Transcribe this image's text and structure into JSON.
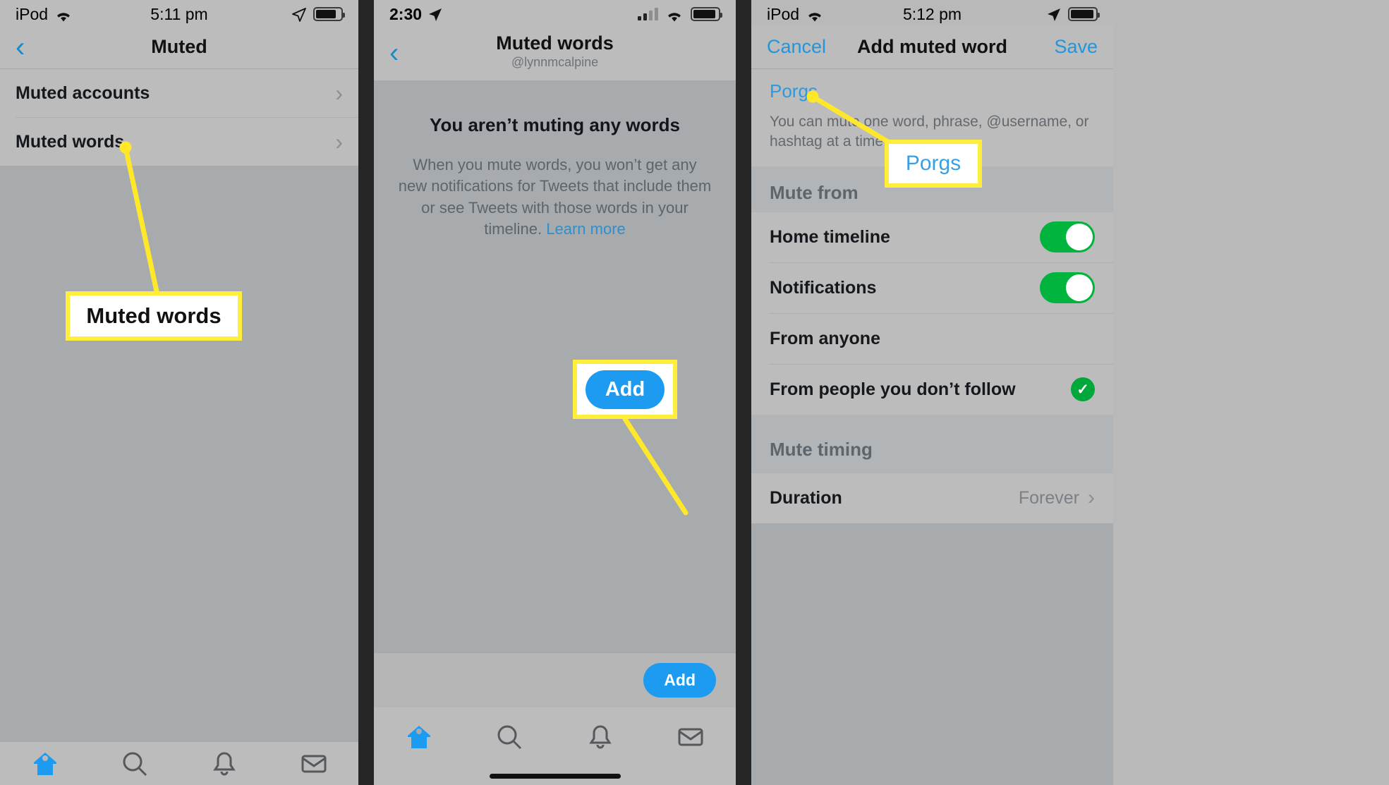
{
  "panel1": {
    "status": {
      "carrier": "iPod",
      "wifi_icon": "wifi-icon",
      "time": "5:11 pm",
      "location_icon": "location-arrow-icon",
      "battery_icon": "battery-icon"
    },
    "nav": {
      "back_icon": "chevron-left-icon",
      "title": "Muted"
    },
    "rows": [
      {
        "label": "Muted accounts",
        "chevron": "chevron-right-icon"
      },
      {
        "label": "Muted words",
        "chevron": "chevron-right-icon"
      }
    ],
    "tabs": [
      "home-icon",
      "search-icon",
      "bell-icon",
      "envelope-icon"
    ]
  },
  "panel2": {
    "status": {
      "time": "2:30",
      "location_icon": "location-arrow-icon",
      "signal_icon": "cell-signal-icon",
      "wifi_icon": "wifi-icon",
      "battery_icon": "battery-icon"
    },
    "nav": {
      "back_icon": "chevron-left-icon",
      "title": "Muted words",
      "subtitle": "@lynnmcalpine"
    },
    "empty": {
      "title": "You aren’t muting any words",
      "body": "When you mute words, you won’t get any new notifications for Tweets that include them or see Tweets with those words in your timeline.",
      "link": "Learn more"
    },
    "add_button": "Add",
    "tabs": [
      "home-icon",
      "search-icon",
      "bell-icon",
      "envelope-icon"
    ]
  },
  "panel3": {
    "status": {
      "carrier": "iPod",
      "wifi_icon": "wifi-icon",
      "time": "5:12 pm",
      "location_icon": "location-arrow-icon",
      "battery_icon": "battery-icon"
    },
    "nav": {
      "cancel": "Cancel",
      "title": "Add muted word",
      "save": "Save"
    },
    "field": {
      "value": "Porgs",
      "hint": "You can mute one word, phrase, @username, or hashtag at a time."
    },
    "section_mute_from": "Mute from",
    "mute_from_rows": [
      {
        "label": "Home timeline",
        "control": "toggle",
        "on": true
      },
      {
        "label": "Notifications",
        "control": "toggle",
        "on": true
      },
      {
        "label": "From anyone",
        "control": "none"
      },
      {
        "label": "From people you don’t follow",
        "control": "check",
        "checked": true,
        "check_glyph": "✓"
      }
    ],
    "section_mute_timing": "Mute timing",
    "timing_rows": [
      {
        "label": "Duration",
        "value": "Forever",
        "chevron": "chevron-right-icon"
      }
    ]
  },
  "annotations": [
    {
      "id": "callout-muted-words",
      "text": "Muted words"
    },
    {
      "id": "callout-add-button",
      "text": "Add"
    },
    {
      "id": "callout-porgs",
      "text": "Porgs"
    }
  ],
  "colors": {
    "accent_blue": "#1d9bf0",
    "link_blue": "#2f8fcd",
    "toggle_green": "#00b43d",
    "callout_yellow": "#ffef3b",
    "panel_bg": "#bcbcbc",
    "content_bg": "#a7abae"
  }
}
